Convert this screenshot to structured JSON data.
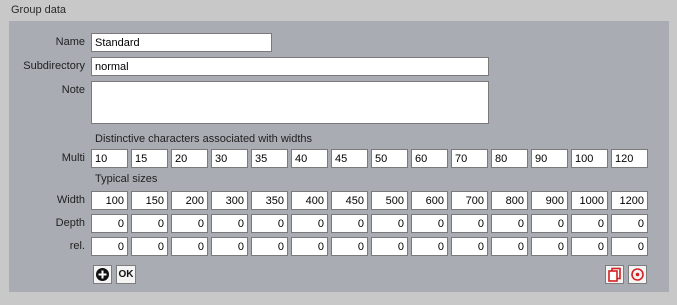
{
  "group_title": "Group data",
  "fields": {
    "name_label": "Name",
    "name_value": "Standard",
    "subdir_label": "Subdirectory",
    "subdir_value": "normal",
    "note_label": "Note",
    "note_value": ""
  },
  "distinctive": {
    "heading": "Distinctive characters associated with widths",
    "row_label": "Multi",
    "values": [
      "10",
      "15",
      "20",
      "30",
      "35",
      "40",
      "45",
      "50",
      "60",
      "70",
      "80",
      "90",
      "100",
      "120"
    ]
  },
  "typical": {
    "heading": "Typical sizes",
    "rows": [
      {
        "label": "Width",
        "values": [
          "100",
          "150",
          "200",
          "300",
          "350",
          "400",
          "450",
          "500",
          "600",
          "700",
          "800",
          "900",
          "1000",
          "1200"
        ]
      },
      {
        "label": "Depth",
        "values": [
          "0",
          "0",
          "0",
          "0",
          "0",
          "0",
          "0",
          "0",
          "0",
          "0",
          "0",
          "0",
          "0",
          "0"
        ]
      },
      {
        "label": "rel.",
        "values": [
          "0",
          "0",
          "0",
          "0",
          "0",
          "0",
          "0",
          "0",
          "0",
          "0",
          "0",
          "0",
          "0",
          "0"
        ]
      }
    ]
  },
  "buttons": {
    "ok_label": "OK"
  },
  "icons": {
    "add": "plus-circle-icon",
    "copy": "copy-icon",
    "target": "target-icon"
  },
  "colors": {
    "panel": "#a9acb3",
    "window": "#c8c8c8",
    "accent_red": "#d42020"
  }
}
